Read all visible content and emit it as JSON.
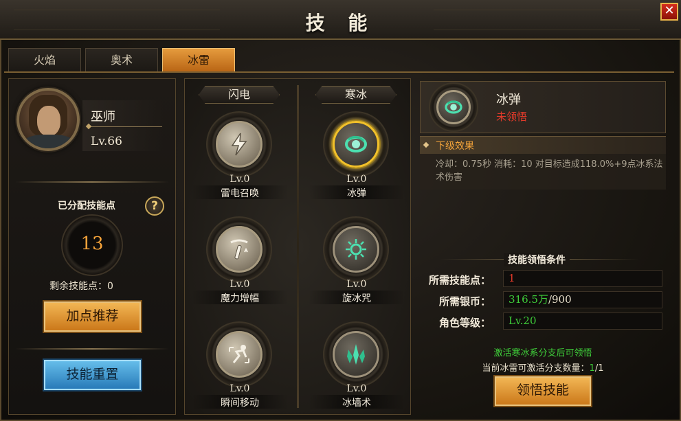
{
  "window": {
    "title": "技 能",
    "close_label": "✕"
  },
  "tabs": [
    {
      "label": "火焰",
      "active": false
    },
    {
      "label": "奥术",
      "active": false
    },
    {
      "label": "冰雷",
      "active": true
    }
  ],
  "hero": {
    "name": "巫师",
    "level": "Lv.66"
  },
  "points": {
    "allocated_label": "已分配技能点",
    "help_label": "?",
    "allocated_value": "13",
    "remaining_label": "剩余技能点：0"
  },
  "left_buttons": {
    "recommend": "加点推荐",
    "reset": "技能重置"
  },
  "columns": [
    {
      "header": "闪电",
      "skills": [
        {
          "level": "Lv.0",
          "name": "雷电召唤",
          "icon": "lightning-icon"
        },
        {
          "level": "Lv.0",
          "name": "魔力增幅",
          "icon": "wand-icon"
        },
        {
          "level": "Lv.0",
          "name": "瞬间移动",
          "icon": "teleport-icon"
        }
      ]
    },
    {
      "header": "寒冰",
      "skills": [
        {
          "level": "Lv.0",
          "name": "冰弹",
          "icon": "ice-orb-icon",
          "selected": true
        },
        {
          "level": "Lv.0",
          "name": "旋冰咒",
          "icon": "ice-swirl-icon"
        },
        {
          "level": "Lv.0",
          "name": "冰墙术",
          "icon": "ice-wall-icon"
        }
      ]
    }
  ],
  "detail": {
    "name": "冰弹",
    "status": "未领悟",
    "effect_title": "下级效果",
    "effect_text": "冷却：0.75秒 消耗：10 对目标造成118.0%+9点冰系法术伤害"
  },
  "conditions": {
    "title": "技能领悟条件",
    "rows": [
      {
        "label": "所需技能点：",
        "value": "1",
        "color": "#e23a2a"
      },
      {
        "label": "所需银币：",
        "value_ok": "316.5万",
        "value_rest": "/900",
        "color": "#3fcf3a"
      },
      {
        "label": "角色等级：",
        "value": "Lv.20",
        "color": "#3fcf3a"
      }
    ]
  },
  "notes": {
    "activate": "激活寒冰系分支后可领悟",
    "branch_prefix": "当前冰雷可激活分支数量：",
    "branch_current": "1",
    "branch_total": "/1"
  },
  "learn_button": "领悟技能",
  "colors": {
    "accent_orange": "#f2a33a",
    "ok_green": "#3fcf3a",
    "warn_red": "#e23a2a",
    "select_gold": "#f2c12a"
  }
}
